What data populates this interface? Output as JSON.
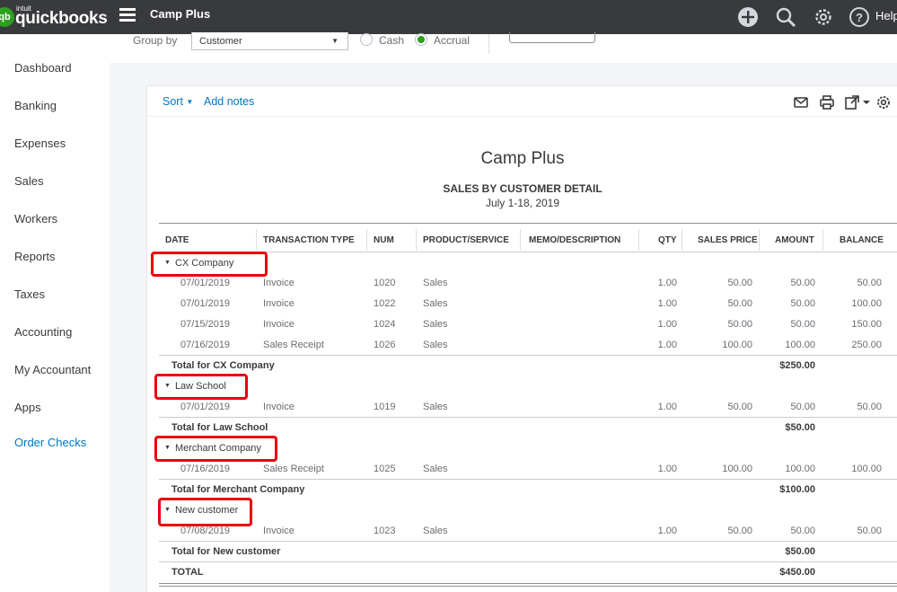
{
  "topbar": {
    "brand_small": "intuit",
    "brand": "quickbooks",
    "brand_badge": "qb",
    "company": "Camp Plus",
    "help_label": "Help"
  },
  "sidebar": {
    "items": [
      {
        "label": "Dashboard"
      },
      {
        "label": "Banking"
      },
      {
        "label": "Expenses"
      },
      {
        "label": "Sales"
      },
      {
        "label": "Workers"
      },
      {
        "label": "Reports"
      },
      {
        "label": "Taxes"
      },
      {
        "label": "Accounting"
      },
      {
        "label": "My Accountant"
      },
      {
        "label": "Apps"
      },
      {
        "label": "Order Checks"
      }
    ]
  },
  "filters": {
    "group_by_label": "Group by",
    "group_by_value": "Customer",
    "cash_label": "Cash",
    "accrual_label": "Accrual",
    "accounting_method": "Accrual"
  },
  "toolbar": {
    "sort_label": "Sort",
    "add_notes_label": "Add notes"
  },
  "report": {
    "company": "Camp Plus",
    "title": "SALES BY CUSTOMER DETAIL",
    "date_range": "July 1-18, 2019",
    "columns": [
      "DATE",
      "TRANSACTION TYPE",
      "NUM",
      "PRODUCT/SERVICE",
      "MEMO/DESCRIPTION",
      "QTY",
      "SALES PRICE",
      "AMOUNT",
      "BALANCE"
    ],
    "groups": [
      {
        "name": "CX Company",
        "rows": [
          {
            "date": "07/01/2019",
            "type": "Invoice",
            "num": "1020",
            "product": "Sales",
            "qty": "1.00",
            "price": "50.00",
            "amount": "50.00",
            "balance": "50.00"
          },
          {
            "date": "07/01/2019",
            "type": "Invoice",
            "num": "1022",
            "product": "Sales",
            "qty": "1.00",
            "price": "50.00",
            "amount": "50.00",
            "balance": "100.00"
          },
          {
            "date": "07/15/2019",
            "type": "Invoice",
            "num": "1024",
            "product": "Sales",
            "qty": "1.00",
            "price": "50.00",
            "amount": "50.00",
            "balance": "150.00"
          },
          {
            "date": "07/16/2019",
            "type": "Sales Receipt",
            "num": "1026",
            "product": "Sales",
            "qty": "1.00",
            "price": "100.00",
            "amount": "100.00",
            "balance": "250.00"
          }
        ],
        "total_label": "Total for CX Company",
        "total": "$250.00"
      },
      {
        "name": "Law School",
        "rows": [
          {
            "date": "07/01/2019",
            "type": "Invoice",
            "num": "1019",
            "product": "Sales",
            "qty": "1.00",
            "price": "50.00",
            "amount": "50.00",
            "balance": "50.00"
          }
        ],
        "total_label": "Total for Law School",
        "total": "$50.00"
      },
      {
        "name": "Merchant Company",
        "rows": [
          {
            "date": "07/16/2019",
            "type": "Sales Receipt",
            "num": "1025",
            "product": "Sales",
            "qty": "1.00",
            "price": "100.00",
            "amount": "100.00",
            "balance": "100.00"
          }
        ],
        "total_label": "Total for Merchant Company",
        "total": "$100.00"
      },
      {
        "name": "New customer",
        "rows": [
          {
            "date": "07/08/2019",
            "type": "Invoice",
            "num": "1023",
            "product": "Sales",
            "qty": "1.00",
            "price": "50.00",
            "amount": "50.00",
            "balance": "50.00"
          }
        ],
        "total_label": "Total for New customer",
        "total": "$50.00"
      }
    ],
    "grand_total_label": "TOTAL",
    "grand_total": "$450.00"
  },
  "colors": {
    "topbar": "#393a3d",
    "accent_green": "#2ca01c",
    "link_blue": "#0077c5",
    "highlight_red": "#e8000b"
  }
}
